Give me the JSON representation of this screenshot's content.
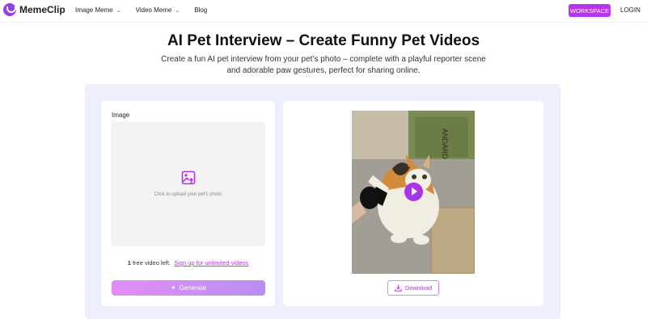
{
  "header": {
    "logo_text": "MemeClip",
    "nav": [
      {
        "label": "Image Meme",
        "has_dropdown": true
      },
      {
        "label": "Video Meme",
        "has_dropdown": true
      },
      {
        "label": "Blog",
        "has_dropdown": false
      }
    ],
    "workspace_label": "WORKSPACE",
    "login_label": "LOGIN"
  },
  "hero": {
    "title": "AI Pet Interview – Create Funny Pet Videos",
    "subtitle_line1": "Create a fun AI pet interview from your pet’s photo – complete with a playful reporter scene",
    "subtitle_line2": "and adorable paw gestures, perfect for sharing online."
  },
  "form": {
    "image_label": "Image",
    "upload_hint": "Click to upload your pet's photo",
    "free_count": "1",
    "free_text": "free video left.",
    "signup_link": "Sign up for unlimited videos",
    "generate_label": "Generate"
  },
  "preview": {
    "download_label": "Download"
  },
  "colors": {
    "accent": "#b336e8",
    "panel_bg": "#eeeffd"
  },
  "icons": {
    "upload": "image-upload-icon",
    "play": "play-icon",
    "download": "download-icon",
    "generate": "sparkle-icon"
  }
}
